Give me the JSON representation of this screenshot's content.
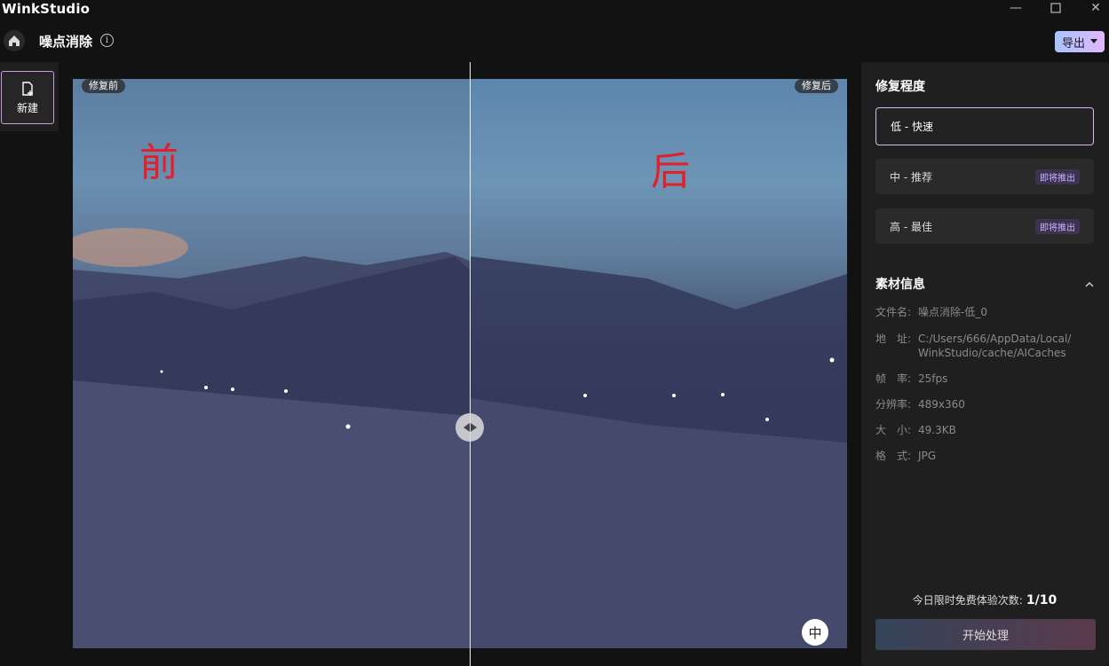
{
  "app": {
    "title": "WinkStudio"
  },
  "header": {
    "page_title": "噪点消除",
    "export_label": "导出"
  },
  "left_rail": {
    "new_label": "新建"
  },
  "canvas": {
    "before_tag": "修复前",
    "after_tag": "修复后",
    "before_char": "前",
    "after_char": "后",
    "compare_icon": "中"
  },
  "panel": {
    "repair_title": "修复程度",
    "options": [
      {
        "label": "低 - 快速",
        "badge": ""
      },
      {
        "label": "中 - 推荐",
        "badge": "即将推出"
      },
      {
        "label": "高 - 最佳",
        "badge": "即将推出"
      }
    ],
    "material_title": "素材信息",
    "info": [
      {
        "label": "文件名:",
        "value": "噪点消除-低_0"
      },
      {
        "label": "地　址:",
        "value": "C:/Users/666/AppData/Local/WinkStudio/cache/AICaches"
      },
      {
        "label": "帧　率:",
        "value": "25fps"
      },
      {
        "label": "分辨率:",
        "value": "489x360"
      },
      {
        "label": "大　小:",
        "value": "49.3KB"
      },
      {
        "label": "格　式:",
        "value": "JPG"
      }
    ],
    "quota_text": "今日限时免费体验次数:",
    "quota_value": "1/10",
    "start_label": "开始处理"
  },
  "colors": {
    "accent": "#d9b8f0",
    "red_text": "#e0212b"
  }
}
